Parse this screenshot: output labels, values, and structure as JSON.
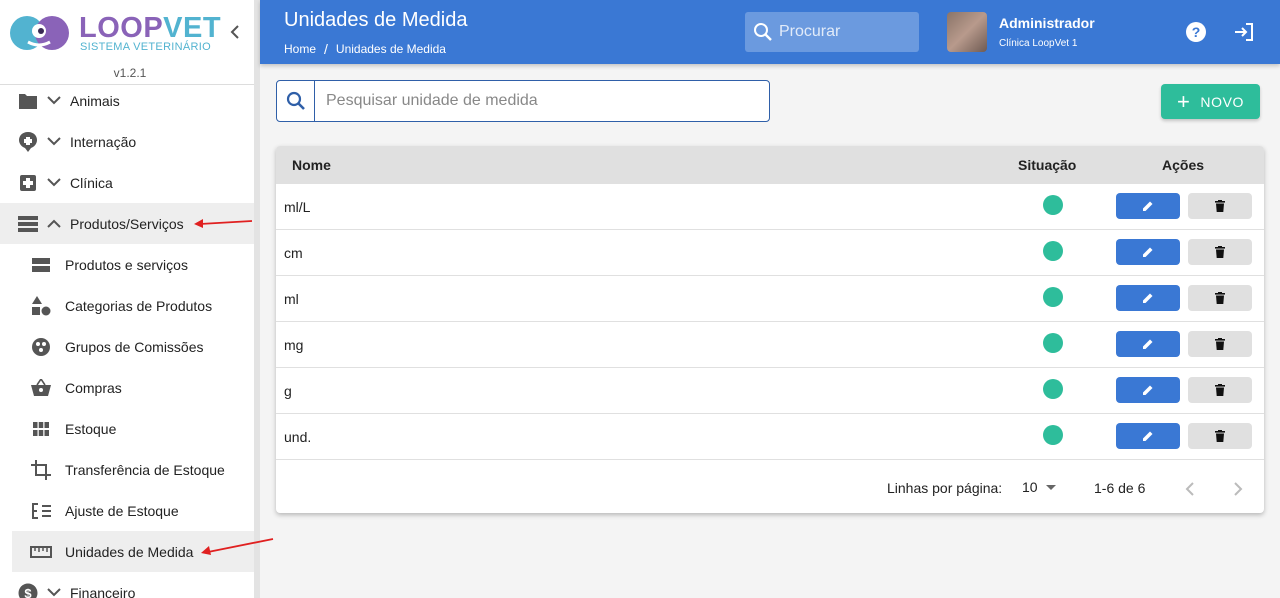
{
  "brand": {
    "name_part1": "LOOP",
    "name_part2": "VET",
    "subtitle": "SISTEMA VETERINÁRIO",
    "version": "v1.2.1",
    "colors": {
      "primary": "#3a78d4",
      "accent": "#2ebd9b",
      "logo_purple": "#8a63b8",
      "logo_blue": "#52b3d0"
    }
  },
  "sidebar": {
    "items": [
      {
        "label": "Animais",
        "icon": "folder-icon"
      },
      {
        "label": "Internação",
        "icon": "hospital-pin-icon"
      },
      {
        "label": "Clínica",
        "icon": "medical-box-icon"
      },
      {
        "label": "Produtos/Serviços",
        "icon": "list-icon"
      }
    ],
    "subitems": [
      {
        "label": "Produtos e serviços",
        "icon": "view-stream-icon"
      },
      {
        "label": "Categorias de Produtos",
        "icon": "shapes-icon"
      },
      {
        "label": "Grupos de Comissões",
        "icon": "group-icon"
      },
      {
        "label": "Compras",
        "icon": "basket-icon"
      },
      {
        "label": "Estoque",
        "icon": "grid-icon"
      },
      {
        "label": "Transferência de Estoque",
        "icon": "crop-icon"
      },
      {
        "label": "Ajuste de Estoque",
        "icon": "adjust-list-icon"
      },
      {
        "label": "Unidades de Medida",
        "icon": "ruler-icon"
      }
    ],
    "bottom_item": {
      "label": "Financeiro",
      "icon": "dollar-icon"
    }
  },
  "header": {
    "title": "Unidades de Medida",
    "breadcrumb": {
      "home": "Home",
      "separator": "/",
      "current": "Unidades de Medida"
    },
    "search_placeholder": "Procurar",
    "user": {
      "name": "Administrador",
      "clinic": "Clínica LoopVet 1"
    }
  },
  "content": {
    "filter_placeholder": "Pesquisar unidade de medida",
    "new_button": "NOVO",
    "table": {
      "headers": {
        "name": "Nome",
        "status": "Situação",
        "actions": "Ações"
      },
      "rows": [
        {
          "name": "ml/L",
          "status": "ativo"
        },
        {
          "name": "cm",
          "status": "ativo"
        },
        {
          "name": "ml",
          "status": "ativo"
        },
        {
          "name": "mg",
          "status": "ativo"
        },
        {
          "name": "g",
          "status": "ativo"
        },
        {
          "name": "und.",
          "status": "ativo"
        }
      ]
    },
    "pagination": {
      "rows_per_page_label": "Linhas por página:",
      "rows_per_page": "10",
      "range": "1-6 de 6"
    }
  }
}
